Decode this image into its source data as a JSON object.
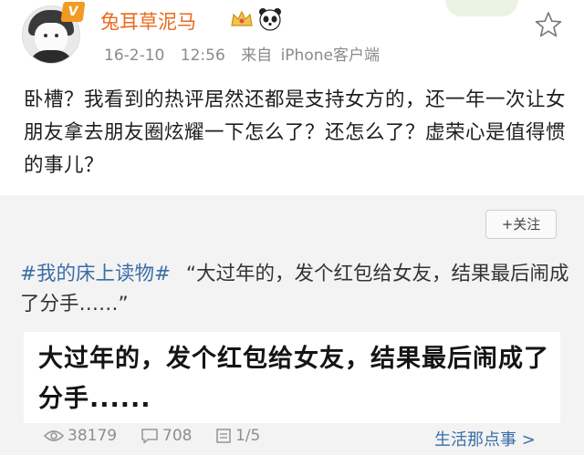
{
  "post": {
    "vip_badge": "V",
    "username": "兔耳草泥马",
    "date": "16-2-10",
    "time": "12:56",
    "source_prefix": "来自",
    "source": "iPhone客户端",
    "text": "卧槽？我看到的热评居然还都是支持女方的，还一年一次让女朋友拿去朋友圈炫耀一下怎么了？还怎么了？虚荣心是值得惯的事儿？"
  },
  "repost": {
    "follow_label": "+关注",
    "topic": "#我的床上读物#",
    "quote": "“大过年的，发个红包给女友，结果最后闹成了分手……”",
    "article_title": "大过年的，发个红包给女友，结果最后闹成了分手......",
    "views": "38179",
    "comments": "708",
    "pages": "1/5",
    "source_link": "生活那点事 >"
  },
  "icons": [
    "crown-icon",
    "panda-icon",
    "star-icon",
    "eye-icon",
    "comment-icon",
    "page-icon"
  ],
  "colors": {
    "username": "#e86a1a",
    "link": "#3b6ea8",
    "meta": "#8a8a8a",
    "card_bg": "#f3f3f3"
  }
}
